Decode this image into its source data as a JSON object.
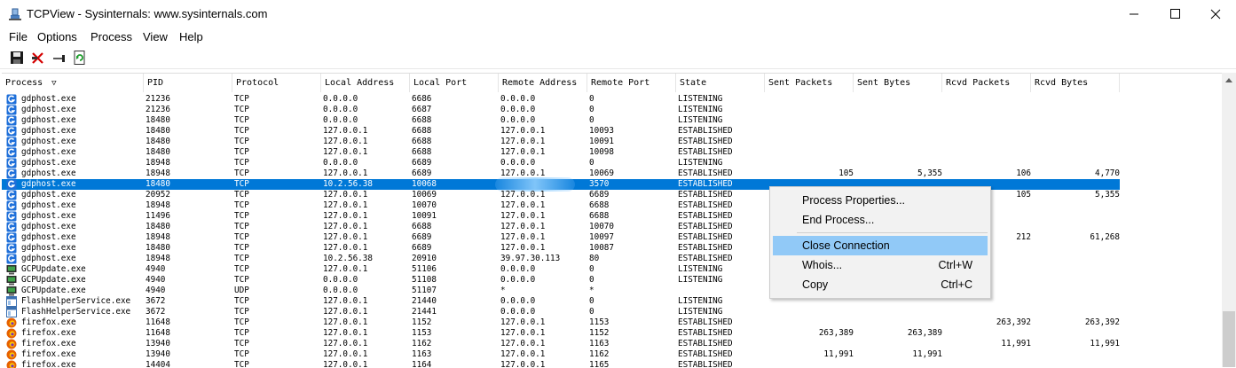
{
  "window": {
    "title": "TCPView - Sysinternals: www.sysinternals.com"
  },
  "menu": [
    "File",
    "Options",
    "Process",
    "View",
    "Help"
  ],
  "toolbar": {
    "buttons": [
      "save-icon",
      "close-connection-icon",
      "resolve-address-icon",
      "refresh-icon"
    ]
  },
  "columns": [
    "Process",
    "PID",
    "Protocol",
    "Local Address",
    "Local Port",
    "Remote Address",
    "Remote Port",
    "State",
    "Sent Packets",
    "Sent Bytes",
    "Rcvd Packets",
    "Rcvd Bytes"
  ],
  "sort_indicator": "▽",
  "rows": [
    {
      "icon": "gdphost",
      "process": "gdphost.exe",
      "pid": "21236",
      "proto": "TCP",
      "laddr": "0.0.0.0",
      "lport": "6686",
      "raddr": "0.0.0.0",
      "rport": "0",
      "state": "LISTENING",
      "sp": "",
      "sb": "",
      "rp": "",
      "rb": ""
    },
    {
      "icon": "gdphost",
      "process": "gdphost.exe",
      "pid": "21236",
      "proto": "TCP",
      "laddr": "0.0.0.0",
      "lport": "6687",
      "raddr": "0.0.0.0",
      "rport": "0",
      "state": "LISTENING",
      "sp": "",
      "sb": "",
      "rp": "",
      "rb": ""
    },
    {
      "icon": "gdphost",
      "process": "gdphost.exe",
      "pid": "18480",
      "proto": "TCP",
      "laddr": "0.0.0.0",
      "lport": "6688",
      "raddr": "0.0.0.0",
      "rport": "0",
      "state": "LISTENING",
      "sp": "",
      "sb": "",
      "rp": "",
      "rb": ""
    },
    {
      "icon": "gdphost",
      "process": "gdphost.exe",
      "pid": "18480",
      "proto": "TCP",
      "laddr": "127.0.0.1",
      "lport": "6688",
      "raddr": "127.0.0.1",
      "rport": "10093",
      "state": "ESTABLISHED",
      "sp": "",
      "sb": "",
      "rp": "",
      "rb": ""
    },
    {
      "icon": "gdphost",
      "process": "gdphost.exe",
      "pid": "18480",
      "proto": "TCP",
      "laddr": "127.0.0.1",
      "lport": "6688",
      "raddr": "127.0.0.1",
      "rport": "10091",
      "state": "ESTABLISHED",
      "sp": "",
      "sb": "",
      "rp": "",
      "rb": ""
    },
    {
      "icon": "gdphost",
      "process": "gdphost.exe",
      "pid": "18480",
      "proto": "TCP",
      "laddr": "127.0.0.1",
      "lport": "6688",
      "raddr": "127.0.0.1",
      "rport": "10098",
      "state": "ESTABLISHED",
      "sp": "",
      "sb": "",
      "rp": "",
      "rb": ""
    },
    {
      "icon": "gdphost",
      "process": "gdphost.exe",
      "pid": "18948",
      "proto": "TCP",
      "laddr": "0.0.0.0",
      "lport": "6689",
      "raddr": "0.0.0.0",
      "rport": "0",
      "state": "LISTENING",
      "sp": "",
      "sb": "",
      "rp": "",
      "rb": ""
    },
    {
      "icon": "gdphost",
      "process": "gdphost.exe",
      "pid": "18948",
      "proto": "TCP",
      "laddr": "127.0.0.1",
      "lport": "6689",
      "raddr": "127.0.0.1",
      "rport": "10069",
      "state": "ESTABLISHED",
      "sp": "105",
      "sb": "5,355",
      "rp": "106",
      "rb": "4,770"
    },
    {
      "icon": "gdphost",
      "process": "gdphost.exe",
      "pid": "18480",
      "proto": "TCP",
      "laddr": "10.2.56.38",
      "lport": "10068",
      "raddr": "",
      "rport": "3570",
      "state": "ESTABLISHED",
      "sp": "",
      "sb": "",
      "rp": "",
      "rb": "",
      "selected": true
    },
    {
      "icon": "gdphost",
      "process": "gdphost.exe",
      "pid": "20952",
      "proto": "TCP",
      "laddr": "127.0.0.1",
      "lport": "10069",
      "raddr": "127.0.0.1",
      "rport": "6689",
      "state": "ESTABLISHED",
      "sp": "",
      "sb": "",
      "rp": "105",
      "rb": "5,355"
    },
    {
      "icon": "gdphost",
      "process": "gdphost.exe",
      "pid": "18948",
      "proto": "TCP",
      "laddr": "127.0.0.1",
      "lport": "10070",
      "raddr": "127.0.0.1",
      "rport": "6688",
      "state": "ESTABLISHED",
      "sp": "",
      "sb": "",
      "rp": "",
      "rb": ""
    },
    {
      "icon": "gdphost",
      "process": "gdphost.exe",
      "pid": "11496",
      "proto": "TCP",
      "laddr": "127.0.0.1",
      "lport": "10091",
      "raddr": "127.0.0.1",
      "rport": "6688",
      "state": "ESTABLISHED",
      "sp": "",
      "sb": "",
      "rp": "",
      "rb": ""
    },
    {
      "icon": "gdphost",
      "process": "gdphost.exe",
      "pid": "18480",
      "proto": "TCP",
      "laddr": "127.0.0.1",
      "lport": "6688",
      "raddr": "127.0.0.1",
      "rport": "10070",
      "state": "ESTABLISHED",
      "sp": "",
      "sb": "",
      "rp": "",
      "rb": ""
    },
    {
      "icon": "gdphost",
      "process": "gdphost.exe",
      "pid": "18948",
      "proto": "TCP",
      "laddr": "127.0.0.1",
      "lport": "6689",
      "raddr": "127.0.0.1",
      "rport": "10097",
      "state": "ESTABLISHED",
      "sp": "",
      "sb": "",
      "rp": "212",
      "rb": "61,268"
    },
    {
      "icon": "gdphost",
      "process": "gdphost.exe",
      "pid": "18480",
      "proto": "TCP",
      "laddr": "127.0.0.1",
      "lport": "6689",
      "raddr": "127.0.0.1",
      "rport": "10087",
      "state": "ESTABLISHED",
      "sp": "",
      "sb": "",
      "rp": "",
      "rb": ""
    },
    {
      "icon": "gdphost",
      "process": "gdphost.exe",
      "pid": "18948",
      "proto": "TCP",
      "laddr": "10.2.56.38",
      "lport": "20910",
      "raddr": "39.97.30.113",
      "rport": "80",
      "state": "ESTABLISHED",
      "sp": "",
      "sb": "",
      "rp": "",
      "rb": ""
    },
    {
      "icon": "gcp",
      "process": "GCPUpdate.exe",
      "pid": "4940",
      "proto": "TCP",
      "laddr": "127.0.0.1",
      "lport": "51106",
      "raddr": "0.0.0.0",
      "rport": "0",
      "state": "LISTENING",
      "sp": "",
      "sb": "",
      "rp": "",
      "rb": ""
    },
    {
      "icon": "gcp",
      "process": "GCPUpdate.exe",
      "pid": "4940",
      "proto": "TCP",
      "laddr": "0.0.0.0",
      "lport": "51108",
      "raddr": "0.0.0.0",
      "rport": "0",
      "state": "LISTENING",
      "sp": "",
      "sb": "",
      "rp": "",
      "rb": ""
    },
    {
      "icon": "gcp",
      "process": "GCPUpdate.exe",
      "pid": "4940",
      "proto": "UDP",
      "laddr": "0.0.0.0",
      "lport": "51107",
      "raddr": "*",
      "rport": "*",
      "state": "",
      "sp": "",
      "sb": "",
      "rp": "",
      "rb": ""
    },
    {
      "icon": "flash",
      "process": "FlashHelperService.exe",
      "pid": "3672",
      "proto": "TCP",
      "laddr": "127.0.0.1",
      "lport": "21440",
      "raddr": "0.0.0.0",
      "rport": "0",
      "state": "LISTENING",
      "sp": "",
      "sb": "",
      "rp": "",
      "rb": ""
    },
    {
      "icon": "flash",
      "process": "FlashHelperService.exe",
      "pid": "3672",
      "proto": "TCP",
      "laddr": "127.0.0.1",
      "lport": "21441",
      "raddr": "0.0.0.0",
      "rport": "0",
      "state": "LISTENING",
      "sp": "",
      "sb": "",
      "rp": "",
      "rb": ""
    },
    {
      "icon": "firefox",
      "process": "firefox.exe",
      "pid": "11648",
      "proto": "TCP",
      "laddr": "127.0.0.1",
      "lport": "1152",
      "raddr": "127.0.0.1",
      "rport": "1153",
      "state": "ESTABLISHED",
      "sp": "",
      "sb": "",
      "rp": "263,392",
      "rb": "263,392"
    },
    {
      "icon": "firefox",
      "process": "firefox.exe",
      "pid": "11648",
      "proto": "TCP",
      "laddr": "127.0.0.1",
      "lport": "1153",
      "raddr": "127.0.0.1",
      "rport": "1152",
      "state": "ESTABLISHED",
      "sp": "263,389",
      "sb": "263,389",
      "rp": "",
      "rb": ""
    },
    {
      "icon": "firefox",
      "process": "firefox.exe",
      "pid": "13940",
      "proto": "TCP",
      "laddr": "127.0.0.1",
      "lport": "1162",
      "raddr": "127.0.0.1",
      "rport": "1163",
      "state": "ESTABLISHED",
      "sp": "",
      "sb": "",
      "rp": "11,991",
      "rb": "11,991"
    },
    {
      "icon": "firefox",
      "process": "firefox.exe",
      "pid": "13940",
      "proto": "TCP",
      "laddr": "127.0.0.1",
      "lport": "1163",
      "raddr": "127.0.0.1",
      "rport": "1162",
      "state": "ESTABLISHED",
      "sp": "11,991",
      "sb": "11,991",
      "rp": "",
      "rb": ""
    },
    {
      "icon": "firefox",
      "process": "firefox.exe",
      "pid": "14404",
      "proto": "TCP",
      "laddr": "127.0.0.1",
      "lport": "1164",
      "raddr": "127.0.0.1",
      "rport": "1165",
      "state": "ESTABLISHED",
      "sp": "",
      "sb": "",
      "rp": "",
      "rb": ""
    }
  ],
  "context_menu": {
    "items": [
      {
        "label": "Process Properties...",
        "shortcut": "",
        "highlighted": false
      },
      {
        "label": "End Process...",
        "shortcut": "",
        "highlighted": false
      },
      {
        "label": "Close Connection",
        "shortcut": "",
        "highlighted": true
      },
      {
        "label": "Whois...",
        "shortcut": "Ctrl+W",
        "highlighted": false
      },
      {
        "label": "Copy",
        "shortcut": "Ctrl+C",
        "highlighted": false
      }
    ]
  },
  "colors": {
    "selection": "#0078d7",
    "menu_highlight": "#91c9f7",
    "gdphost_icon": "#1e6fd9"
  }
}
